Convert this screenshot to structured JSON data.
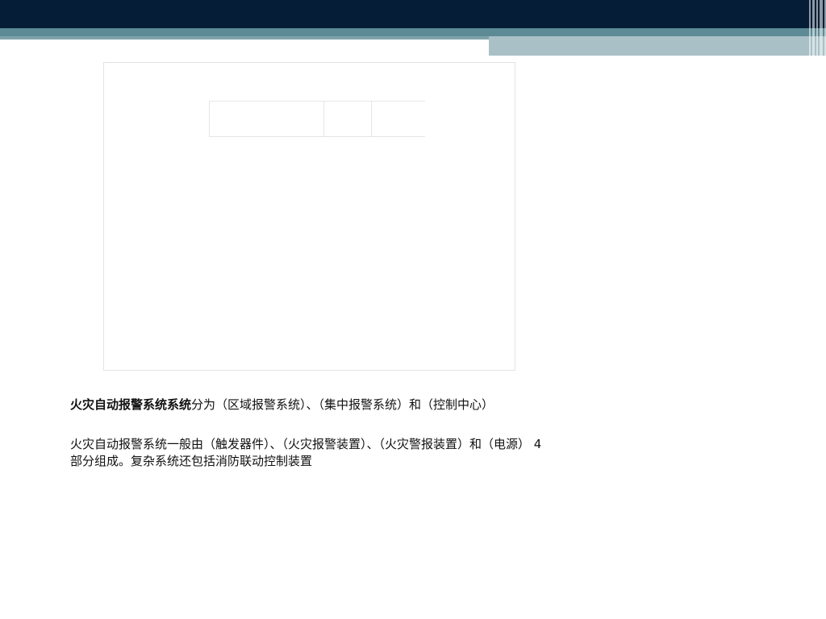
{
  "header": {
    "colors": {
      "navy": "#061d37",
      "teal": "#5d8a95",
      "light_teal": "#a9c0c6"
    }
  },
  "content": {
    "paragraph1": {
      "bold_lead": "火灾自动报警系统系统",
      "rest": "分为（区域报警系统）、（集中报警系统）和（控制中心）"
    },
    "paragraph2": {
      "text": "火灾自动报警系统一般由（触发器件）、（火灾报警装置）、（火灾警报装置）和（电源） 4 部分组成。复杂系统还包括消防联动控制装置"
    }
  }
}
